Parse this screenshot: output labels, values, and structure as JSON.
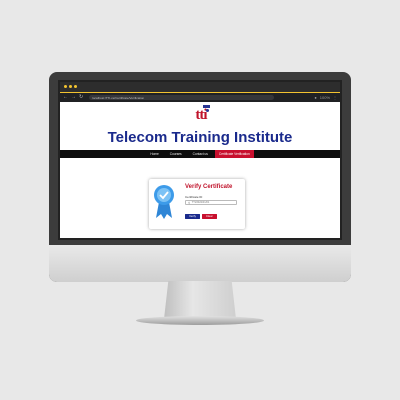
{
  "browser": {
    "url": "localhost:/TTI-ce/Certificate/Verification",
    "zoom": "100%",
    "icons": [
      "back-icon",
      "forward-icon",
      "reload-icon",
      "home-icon"
    ]
  },
  "site": {
    "logo_text": "tti",
    "title": "Telecom Training Institute"
  },
  "nav": {
    "items": [
      {
        "label": "Home",
        "active": false
      },
      {
        "label": "Courses",
        "active": false
      },
      {
        "label": "Contact us",
        "active": false
      },
      {
        "label": "Certificate Verification",
        "active": true
      }
    ]
  },
  "verify": {
    "title": "Verify Certificate",
    "field_label": "Certificate ID",
    "field_value": "TTI/2022/01/01",
    "verify_button": "Verify",
    "clear_button": "Clear"
  },
  "colors": {
    "brand_red": "#c0132b",
    "brand_blue": "#1a2a8c",
    "window_accent": "#f2c230"
  }
}
